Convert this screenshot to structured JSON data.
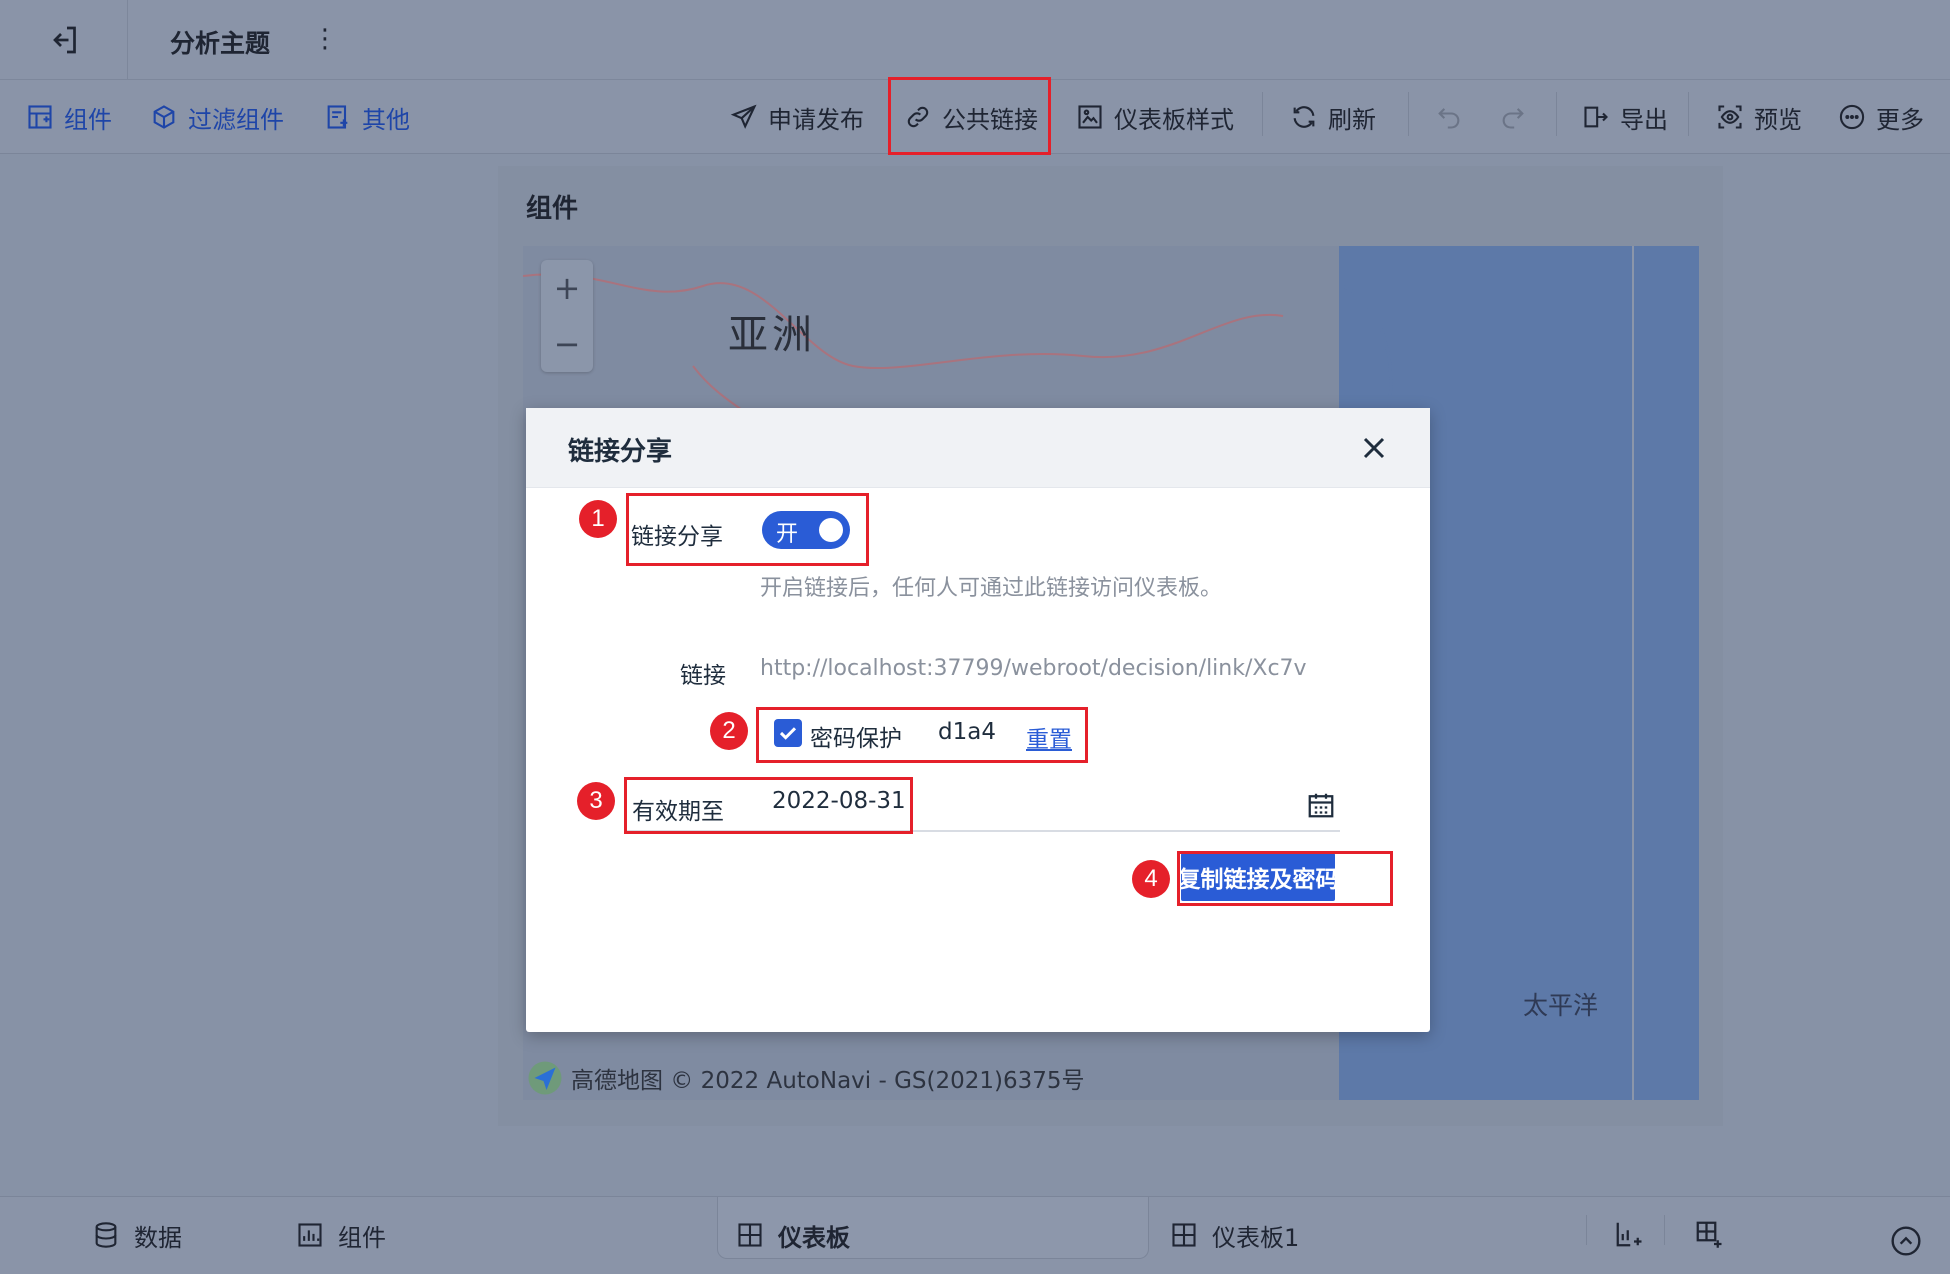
{
  "topbar": {
    "title": "分析主题"
  },
  "toolbar": {
    "left": [
      {
        "label": "组件",
        "icon": "add-widget-icon"
      },
      {
        "label": "过滤组件",
        "icon": "filter-widget-icon"
      },
      {
        "label": "其他",
        "icon": "other-icon"
      }
    ],
    "right": [
      {
        "label": "申请发布",
        "icon": "send-icon"
      },
      {
        "label": "公共链接",
        "icon": "link-icon"
      },
      {
        "label": "仪表板样式",
        "icon": "style-icon"
      },
      {
        "label": "刷新",
        "icon": "refresh-icon"
      },
      {
        "label": "导出",
        "icon": "export-icon"
      },
      {
        "label": "预览",
        "icon": "preview-icon"
      },
      {
        "label": "更多",
        "icon": "more-icon"
      }
    ]
  },
  "panel": {
    "title": "组件"
  },
  "map": {
    "zoom_in": "+",
    "zoom_out": "−",
    "region_label": "亚洲",
    "ocean_label": "太平洋",
    "attribution": "高德地图 © 2022 AutoNavi - GS(2021)6375号"
  },
  "modal": {
    "title": "链接分享",
    "share_label": "链接分享",
    "toggle_text": "开",
    "toggle_on": true,
    "hint": "开启链接后，任何人可通过此链接访问仪表板。",
    "link_label": "链接",
    "link_url": "http://localhost:37799/webroot/decision/link/Xc7v",
    "password_label": "密码保护",
    "password_checked": true,
    "password_value": "d1a4",
    "reset_label": "重置",
    "expire_label": "有效期至",
    "expire_date": "2022-08-31",
    "copy_button": "复制链接及密码"
  },
  "badges": [
    "1",
    "2",
    "3",
    "4"
  ],
  "bottombar": {
    "tabs": [
      {
        "label": "数据",
        "icon": "database-icon"
      },
      {
        "label": "组件",
        "icon": "chart-icon"
      },
      {
        "label": "仪表板",
        "icon": "dashboard-icon",
        "active": true
      },
      {
        "label": "仪表板1",
        "icon": "dashboard-icon"
      }
    ]
  },
  "colors": {
    "accent": "#2a5cd6",
    "highlight": "#e5202a"
  }
}
